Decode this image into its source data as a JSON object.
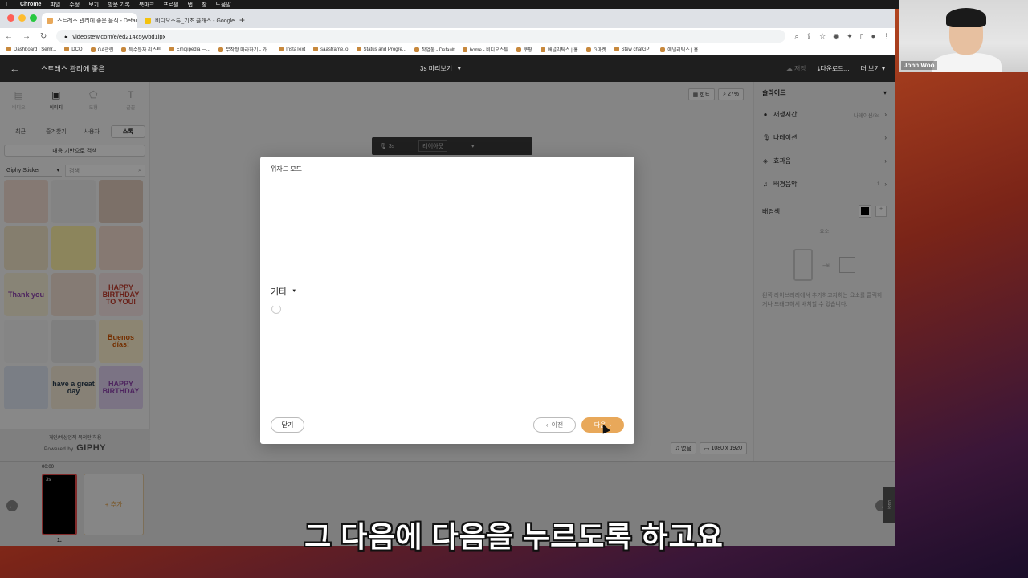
{
  "menubar": {
    "items": [
      "Chrome",
      "파일",
      "수정",
      "보기",
      "방문 기록",
      "북마크",
      "프로필",
      "탭",
      "창",
      "도움말"
    ]
  },
  "browser": {
    "tabs": [
      {
        "label": "스트레스 관리에 좋은 음식 - Default",
        "color": "#e8a85a"
      },
      {
        "label": "비디오스튜_기초 클래스 - Google",
        "color": "#f4c20d"
      }
    ],
    "url": "videostew.com/e/ed214c5yvbd1lpx",
    "bookmarks": [
      "Dashboard | Semr...",
      "DCO",
      "GA관련",
      "특수문자 리스트",
      "Emojipedia —...",
      "무작정 따라하기 - 가...",
      "InstaText",
      "saasframe.io",
      "Status and Progre...",
      "작업물 - Default",
      "home - 비디오스튜",
      "쿠팡",
      "애널리틱스 | 홈",
      "G마켓",
      "Stew chatGPT",
      "애널리틱스 | 홈"
    ]
  },
  "app": {
    "project_title": "스트레스 관리에 좋은 ...",
    "preview_label": "3s  미리보기",
    "save_label": "저장",
    "download_label": "다운로드...",
    "more_label": "더 보기"
  },
  "left_panel": {
    "tool_tabs": [
      "비디오",
      "이미지",
      "도형",
      "글꼴"
    ],
    "sub_tabs": [
      "최근",
      "즐겨찾기",
      "사용자",
      "스톡"
    ],
    "content_search": "내용 기반으로 검색",
    "source_select": "Giphy Sticker",
    "search_placeholder": "검색",
    "stickers": [
      {
        "label": "",
        "bg": "#f3ddd2"
      },
      {
        "label": "",
        "bg": "#efefef"
      },
      {
        "label": "",
        "bg": "#e2cdbd"
      },
      {
        "label": "",
        "bg": "#f2e6c8"
      },
      {
        "label": "",
        "bg": "#fff3a8"
      },
      {
        "label": "",
        "bg": "#f4dccf"
      },
      {
        "label": "Thank you",
        "bg": "#f7f1d8"
      },
      {
        "label": "",
        "bg": "#f2e1d3"
      },
      {
        "label": "HAPPY BIRTHDAY TO YOU!",
        "bg": "#f8e6e6"
      },
      {
        "label": "",
        "bg": "#f2f2f2"
      },
      {
        "label": "",
        "bg": "#e8e8e8"
      },
      {
        "label": "Buenos días!",
        "bg": "#fff3cf"
      },
      {
        "label": "",
        "bg": "#dfe6f2"
      },
      {
        "label": "have a great day",
        "bg": "#f6ecd8"
      },
      {
        "label": "HAPPY BIRTHDAY",
        "bg": "#e0d2f0"
      }
    ],
    "footer_notice": "개인/비상업적 목적만 허용",
    "powered_by": "Powered by",
    "giphy_label": "GIPHY"
  },
  "canvas": {
    "hint_label": "힌트",
    "zoom_label": "27%",
    "voice_duration": "3s",
    "layout_label": "레이아웃",
    "sound_label": "없음",
    "resolution_label": "1080 x 1920"
  },
  "right_panel": {
    "title": "슬라이드",
    "rows": [
      {
        "label": "재생시간",
        "value": "나레이션/3s"
      },
      {
        "label": "나레이션",
        "value": ""
      },
      {
        "label": "효과음",
        "value": ""
      },
      {
        "label": "배경음악",
        "value": "1"
      }
    ],
    "background_color_label": "배경색",
    "element_label": "요소",
    "hint_text": "왼쪽 라이브러리에서 추가하고자하는 요소를 클릭하거나 드래그해서 배치할 수 있습니다.",
    "feedback_label": "문의"
  },
  "timeline": {
    "timecode": "00:00",
    "slide_duration": "3s",
    "slide_number": "1.",
    "add_label": "+ 추가"
  },
  "modal": {
    "title": "위자드 모드",
    "category": "기타",
    "close_label": "닫기",
    "prev_label": "이전",
    "next_label": "다음"
  },
  "caption": "그 다음에 다음을 누르도록 하고요",
  "webcam": {
    "name": "John Woo"
  }
}
